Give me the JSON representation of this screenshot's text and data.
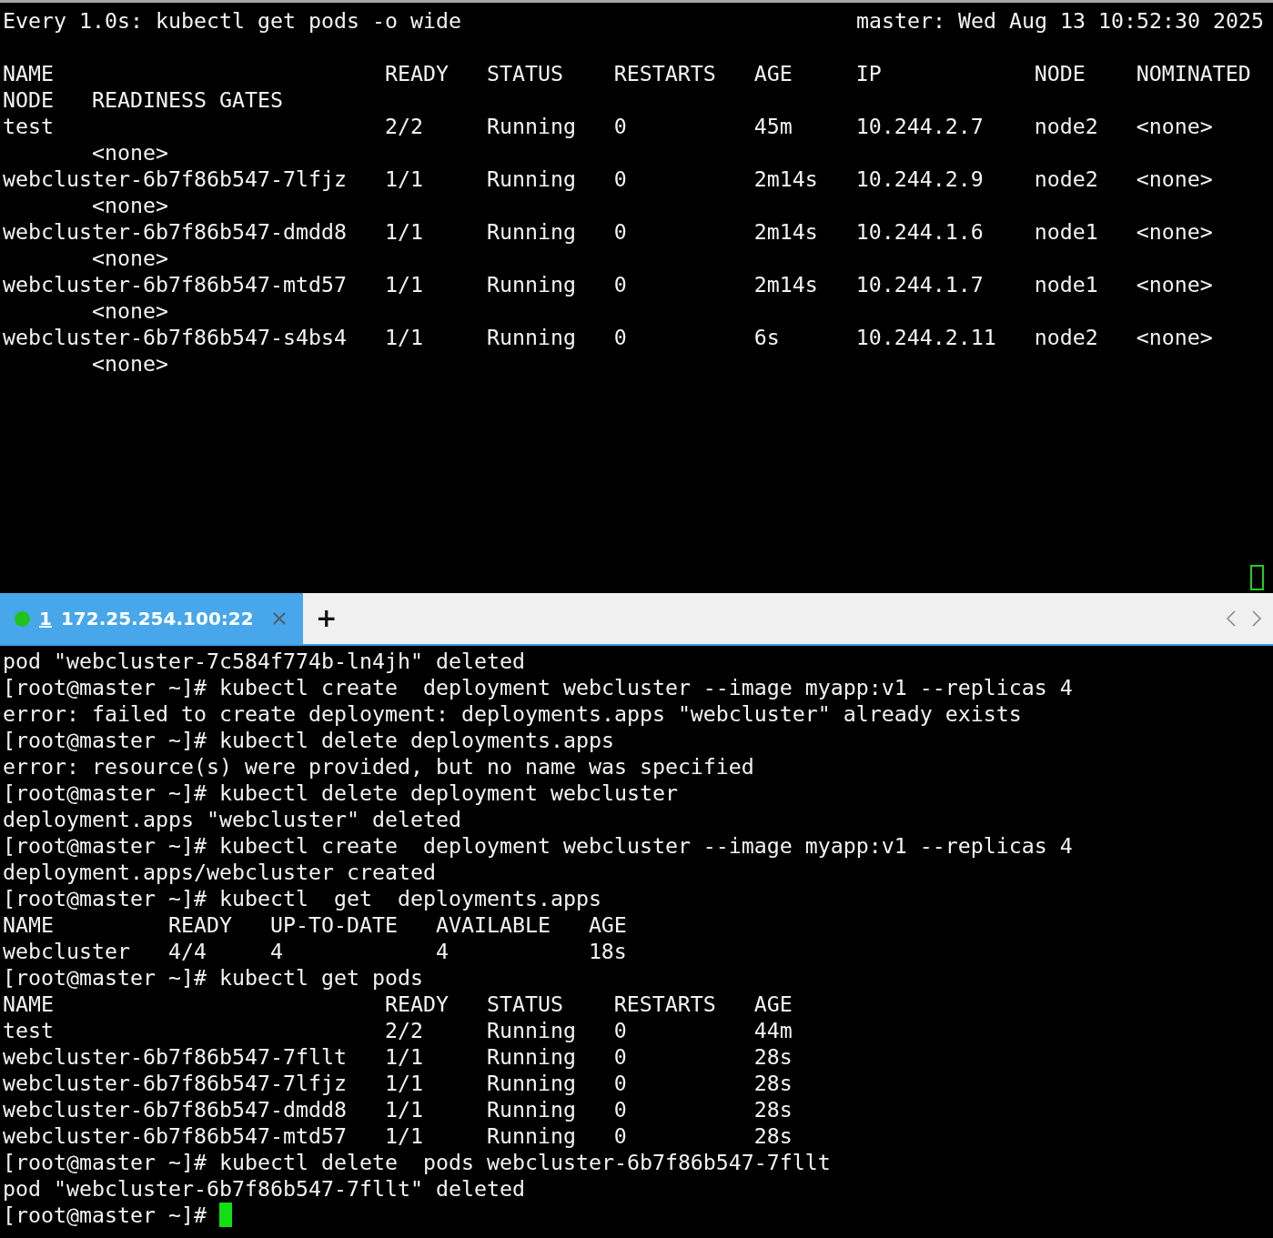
{
  "watch_pane": {
    "command": "Every 1.0s: kubectl get pods -o wide",
    "host_time": "master: Wed Aug 13 10:52:30 2025",
    "columns": [
      "NAME",
      "READY",
      "STATUS",
      "RESTARTS",
      "AGE",
      "IP",
      "NODE",
      "NOMINATED"
    ],
    "wrapped_columns": [
      "NODE",
      "READINESS GATES"
    ],
    "rows": [
      {
        "cells": [
          "test",
          "2/2",
          "Running",
          "0",
          "45m",
          "10.244.2.7",
          "node2",
          "<none>"
        ],
        "wrapped": "<none>"
      },
      {
        "cells": [
          "webcluster-6b7f86b547-7lfjz",
          "1/1",
          "Running",
          "0",
          "2m14s",
          "10.244.2.9",
          "node2",
          "<none>"
        ],
        "wrapped": "<none>"
      },
      {
        "cells": [
          "webcluster-6b7f86b547-dmdd8",
          "1/1",
          "Running",
          "0",
          "2m14s",
          "10.244.1.6",
          "node1",
          "<none>"
        ],
        "wrapped": "<none>"
      },
      {
        "cells": [
          "webcluster-6b7f86b547-mtd57",
          "1/1",
          "Running",
          "0",
          "2m14s",
          "10.244.1.7",
          "node1",
          "<none>"
        ],
        "wrapped": "<none>"
      },
      {
        "cells": [
          "webcluster-6b7f86b547-s4bs4",
          "1/1",
          "Running",
          "0",
          "6s",
          "10.244.2.11",
          "node2",
          "<none>"
        ],
        "wrapped": "<none>"
      }
    ]
  },
  "tab_bar": {
    "tabs": [
      {
        "number": "1",
        "label": "172.25.254.100:22",
        "selected": true,
        "connected": true
      }
    ],
    "new_tab": "+"
  },
  "terminal": {
    "lines": [
      {
        "kind": "text",
        "text": "pod \"webcluster-7c584f774b-ln4jh\" deleted"
      },
      {
        "kind": "text",
        "text": "[root@master ~]# kubectl create  deployment webcluster --image myapp:v1 --replicas 4"
      },
      {
        "kind": "text",
        "text": "error: failed to create deployment: deployments.apps \"webcluster\" already exists"
      },
      {
        "kind": "text",
        "text": "[root@master ~]# kubectl delete deployments.apps"
      },
      {
        "kind": "text",
        "text": "error: resource(s) were provided, but no name was specified"
      },
      {
        "kind": "text",
        "text": "[root@master ~]# kubectl delete deployment webcluster"
      },
      {
        "kind": "text",
        "text": "deployment.apps \"webcluster\" deleted"
      },
      {
        "kind": "text",
        "text": "[root@master ~]# kubectl create  deployment webcluster --image myapp:v1 --replicas 4"
      },
      {
        "kind": "text",
        "text": "deployment.apps/webcluster created"
      },
      {
        "kind": "text",
        "text": "[root@master ~]# kubectl  get  deployments.apps"
      },
      {
        "kind": "table",
        "columns": [
          "NAME",
          "READY",
          "UP-TO-DATE",
          "AVAILABLE",
          "AGE"
        ],
        "rows": [
          [
            "webcluster",
            "4/4",
            "4",
            "4",
            "18s"
          ]
        ]
      },
      {
        "kind": "text",
        "text": "[root@master ~]# kubectl get pods"
      },
      {
        "kind": "table",
        "columns": [
          "NAME",
          "READY",
          "STATUS",
          "RESTARTS",
          "AGE"
        ],
        "rows": [
          [
            "test",
            "2/2",
            "Running",
            "0",
            "44m"
          ],
          [
            "webcluster-6b7f86b547-7fllt",
            "1/1",
            "Running",
            "0",
            "28s"
          ],
          [
            "webcluster-6b7f86b547-7lfjz",
            "1/1",
            "Running",
            "0",
            "28s"
          ],
          [
            "webcluster-6b7f86b547-dmdd8",
            "1/1",
            "Running",
            "0",
            "28s"
          ],
          [
            "webcluster-6b7f86b547-mtd57",
            "1/1",
            "Running",
            "0",
            "28s"
          ]
        ]
      },
      {
        "kind": "text",
        "text": "[root@master ~]# kubectl delete  pods webcluster-6b7f86b547-7fllt"
      },
      {
        "kind": "text",
        "text": "pod \"webcluster-6b7f86b547-7fllt\" deleted"
      },
      {
        "kind": "prompt",
        "text": "[root@master ~]#"
      }
    ]
  }
}
